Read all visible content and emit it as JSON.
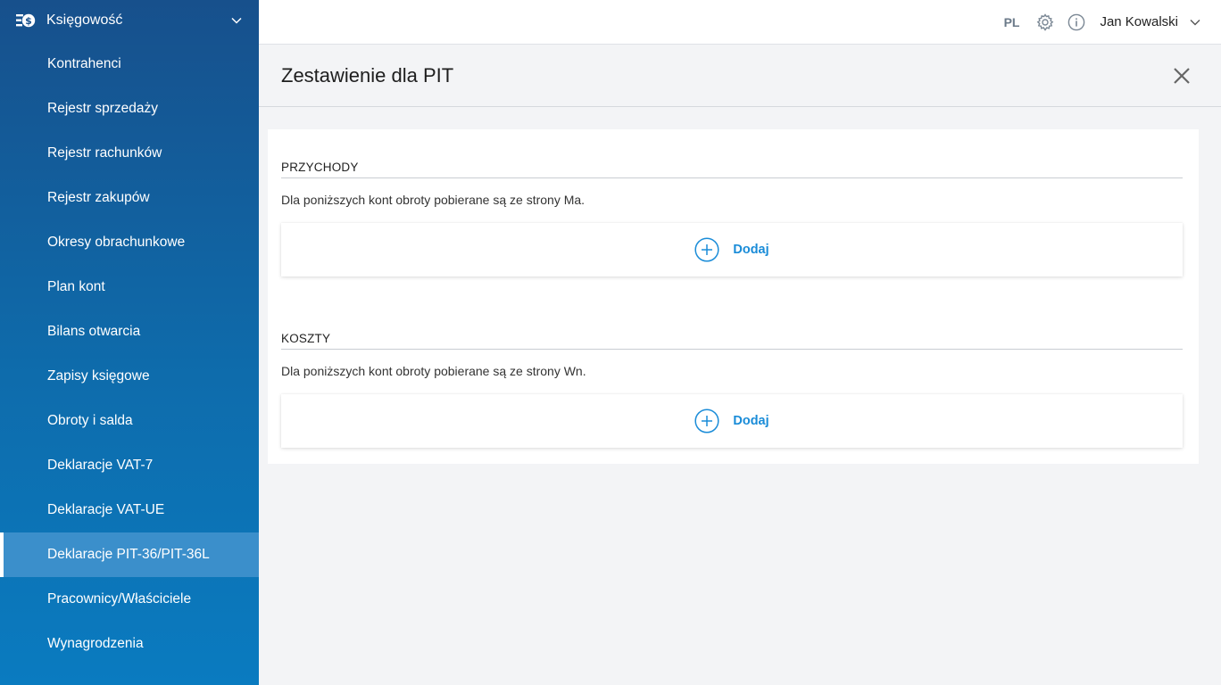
{
  "sidebar": {
    "module_label": "Księgowość",
    "module_icon": "accounting-icon",
    "items": [
      {
        "label": "Kontrahenci"
      },
      {
        "label": "Rejestr sprzedaży"
      },
      {
        "label": "Rejestr rachunków"
      },
      {
        "label": "Rejestr zakupów"
      },
      {
        "label": "Okresy obrachunkowe"
      },
      {
        "label": "Plan kont"
      },
      {
        "label": "Bilans otwarcia"
      },
      {
        "label": "Zapisy księgowe"
      },
      {
        "label": "Obroty i salda"
      },
      {
        "label": "Deklaracje VAT-7"
      },
      {
        "label": "Deklaracje VAT-UE"
      },
      {
        "label": "Deklaracje PIT-36/PIT-36L",
        "active": true
      },
      {
        "label": "Pracownicy/Właściciele"
      },
      {
        "label": "Wynagrodzenia"
      }
    ]
  },
  "topbar": {
    "language": "PL",
    "settings_icon": "gear-icon",
    "info_icon": "info-icon",
    "user_name": "Jan Kowalski"
  },
  "page": {
    "title": "Zestawienie dla PIT"
  },
  "sections": {
    "income": {
      "title": "PRZYCHODY",
      "description": "Dla poniższych kont obroty pobierane są ze strony Ma.",
      "add_label": "Dodaj"
    },
    "costs": {
      "title": "KOSZTY",
      "description": "Dla poniższych kont obroty pobierane są ze strony Wn.",
      "add_label": "Dodaj"
    }
  },
  "colors": {
    "accent": "#1a8cd8",
    "sidebar_top": "#17508c",
    "sidebar_bottom": "#0a7bc0",
    "sidebar_active": "#3b8fcb"
  }
}
